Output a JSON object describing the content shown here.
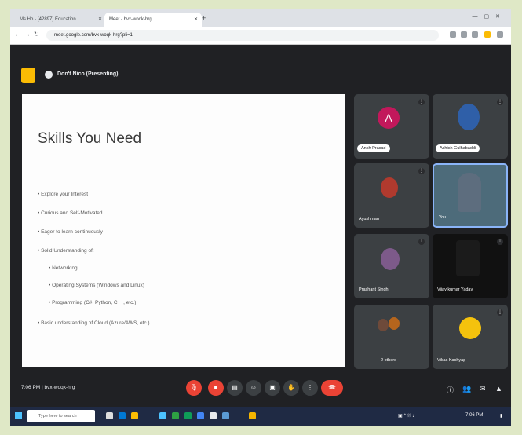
{
  "browser": {
    "tabs": [
      {
        "label": "Ms Ho - (42897) Education"
      },
      {
        "label": "Meet - bvx-woqk-hrg"
      }
    ],
    "url": "meet.google.com/bvx-woqk-hrg?pli=1"
  },
  "meet": {
    "presenting_label": "Don't Nico (Presenting)"
  },
  "slide": {
    "title": "Skills You Need",
    "bullets": [
      "Explore your Interest",
      "Curious and Self-Motivated",
      "Eager to learn continuously",
      "Solid Understanding of:"
    ],
    "sub_bullets": [
      "Networking",
      "Operating Systems (Windows and Linux)",
      "Programming (C#, Python, C++, etc.)"
    ],
    "last_bullet": "Basic understanding of Cloud (Azure/AWS, etc.)"
  },
  "participants": [
    {
      "name": "Ansh Prasad",
      "initial": "A",
      "color": "#c2185b"
    },
    {
      "name": "Ashish Gulhabaddi",
      "color": "#2f5fa8"
    },
    {
      "name": "Ayushman",
      "color": "#b03a2e"
    },
    {
      "name": "You",
      "color": "#5d6d7e"
    },
    {
      "name": "Prashant Singh",
      "color": "#7d5a8a"
    },
    {
      "name": "Vijay kumar Yadav",
      "color": "#1b1b1b"
    },
    {
      "name": "2 others",
      "color": "#6e4a3a"
    },
    {
      "name": "Vikas Kashyap",
      "color": "#f4c20d"
    }
  ],
  "bottombar": {
    "time_code": "7:06 PM | bvx-woqk-hrg"
  },
  "taskbar": {
    "search_placeholder": "Type here to search",
    "clock": "7:06 PM"
  }
}
